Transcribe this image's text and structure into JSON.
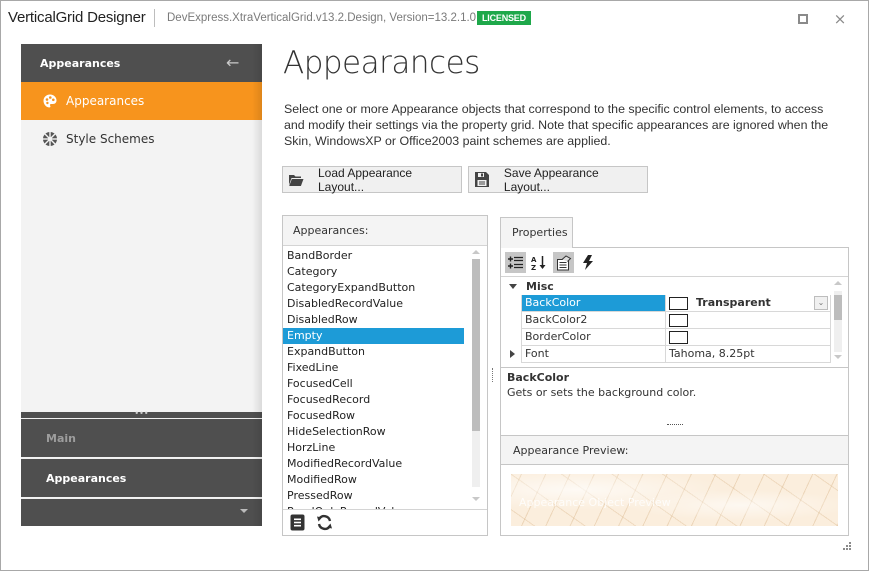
{
  "window": {
    "title": "VerticalGrid Designer",
    "assembly": "DevExpress.XtraVerticalGrid.v13.2.Design, Version=13.2.1.0",
    "license_badge": "LICENSED",
    "controls": {
      "maximize_icon": "maximize-icon",
      "close_glyph": "×"
    }
  },
  "sidebar": {
    "header_title": "Appearances",
    "back_glyph": "←",
    "items": [
      {
        "label": "Appearances",
        "icon": "palette-icon",
        "active": true
      },
      {
        "label": "Style Schemes",
        "icon": "style-schemes-icon",
        "active": false
      }
    ],
    "splitter_glyph": "•••",
    "groups": [
      {
        "label": "Main",
        "active": false
      },
      {
        "label": "Appearances",
        "active": true
      }
    ]
  },
  "main": {
    "title": "Appearances",
    "description": "Select one or more Appearance objects that correspond to the specific control elements, to access and modify their settings via the property grid. Note that specific appearances are ignored when the Skin, WindowsXP or Office2003 paint schemes are applied.",
    "buttons": {
      "load": "Load Appearance Layout...",
      "save": "Save Appearance Layout..."
    }
  },
  "appearances_list": {
    "header": "Appearances:",
    "items": [
      "BandBorder",
      "Category",
      "CategoryExpandButton",
      "DisabledRecordValue",
      "DisabledRow",
      "Empty",
      "ExpandButton",
      "FixedLine",
      "FocusedCell",
      "FocusedRecord",
      "FocusedRow",
      "HideSelectionRow",
      "HorzLine",
      "ModifiedRecordValue",
      "ModifiedRow",
      "PressedRow",
      "ReadOnlyRecordValue"
    ],
    "selected_index": 5,
    "footer_icons": [
      "show-description-icon",
      "reset-icon"
    ]
  },
  "properties": {
    "tab_label": "Properties",
    "toolbar": [
      {
        "name": "categorized-icon",
        "active": true
      },
      {
        "name": "alphabetical-icon",
        "active": false
      },
      {
        "name": "property-pages-icon",
        "active": true
      },
      {
        "name": "events-icon",
        "active": false
      }
    ],
    "category": "Misc",
    "rows": [
      {
        "name": "BackColor",
        "value": "Transparent",
        "swatch": true,
        "selected": true,
        "has_dropdown": true
      },
      {
        "name": "BackColor2",
        "value": "",
        "swatch": true,
        "selected": false
      },
      {
        "name": "BorderColor",
        "value": "",
        "swatch": true,
        "selected": false
      },
      {
        "name": "Font",
        "value": "Tahoma, 8.25pt",
        "swatch": false,
        "selected": false,
        "expandable": true
      }
    ],
    "dropdown_glyph": "⌄",
    "description": {
      "title": "BackColor",
      "text": "Gets or sets the background color."
    }
  },
  "preview": {
    "header": "Appearance Preview:",
    "sample_text": "Appearance Object Preview"
  },
  "colors": {
    "accent_orange": "#f7941d",
    "selection_blue": "#1d9bd7",
    "sidebar_dark": "#4f4f4f",
    "license_green": "#1ea84a"
  }
}
